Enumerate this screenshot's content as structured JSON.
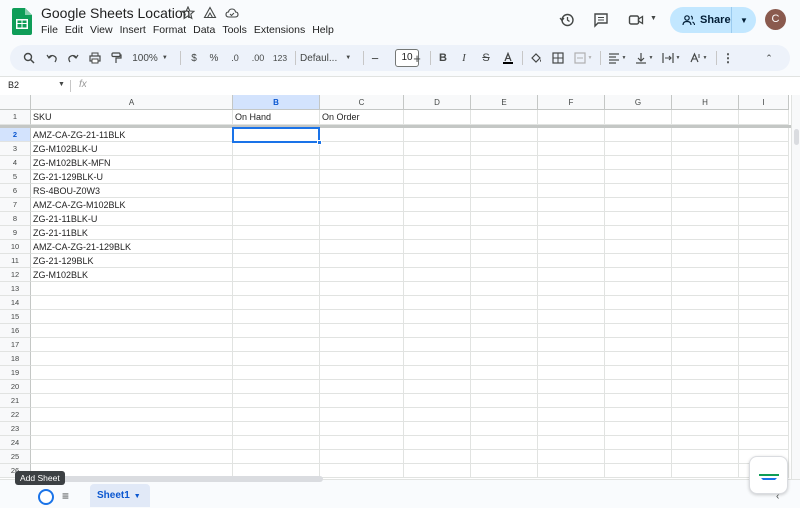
{
  "doc": {
    "title": "Google Sheets Location"
  },
  "menu": [
    "File",
    "Edit",
    "View",
    "Insert",
    "Format",
    "Data",
    "Tools",
    "Extensions",
    "Help"
  ],
  "header": {
    "share_label": "Share",
    "avatar_letter": "C"
  },
  "toolbar": {
    "zoom": "100%",
    "currency": "$",
    "percent": "%",
    "decrease_decimal": ".0",
    "increase_decimal": ".00",
    "number_format": "123",
    "font": "Defaul...",
    "font_size": "10"
  },
  "formula_bar": {
    "name_box": "B2",
    "fx": "fx"
  },
  "grid": {
    "columns": [
      "A",
      "B",
      "C",
      "D",
      "E",
      "F",
      "G",
      "H",
      "I"
    ],
    "rows": [
      "1",
      "2",
      "3",
      "4",
      "5",
      "6",
      "7",
      "8",
      "9",
      "10",
      "11",
      "12",
      "13",
      "14",
      "15",
      "16",
      "17",
      "18",
      "19",
      "20",
      "21",
      "22",
      "23",
      "24",
      "25",
      "26"
    ],
    "cells": {
      "A1": "SKU",
      "B1": "On Hand",
      "C1": "On Order",
      "A2": "AMZ-CA-ZG-21-11BLK",
      "A3": "ZG-M102BLK-U",
      "A4": "ZG-M102BLK-MFN",
      "A5": "ZG-21-129BLK-U",
      "A6": "RS-4BOU-Z0W3",
      "A7": "AMZ-CA-ZG-M102BLK",
      "A8": "ZG-21-11BLK-U",
      "A9": "ZG-21-11BLK",
      "A10": "AMZ-CA-ZG-21-129BLK",
      "A11": "ZG-21-129BLK",
      "A12": "ZG-M102BLK"
    },
    "selected": "B2"
  },
  "sheets": {
    "tooltip": "Add Sheet",
    "active": "Sheet1"
  },
  "colors": {
    "accent": "#1a73e8",
    "share_bg": "#c2e7ff",
    "logo_green": "#0f9d58"
  }
}
